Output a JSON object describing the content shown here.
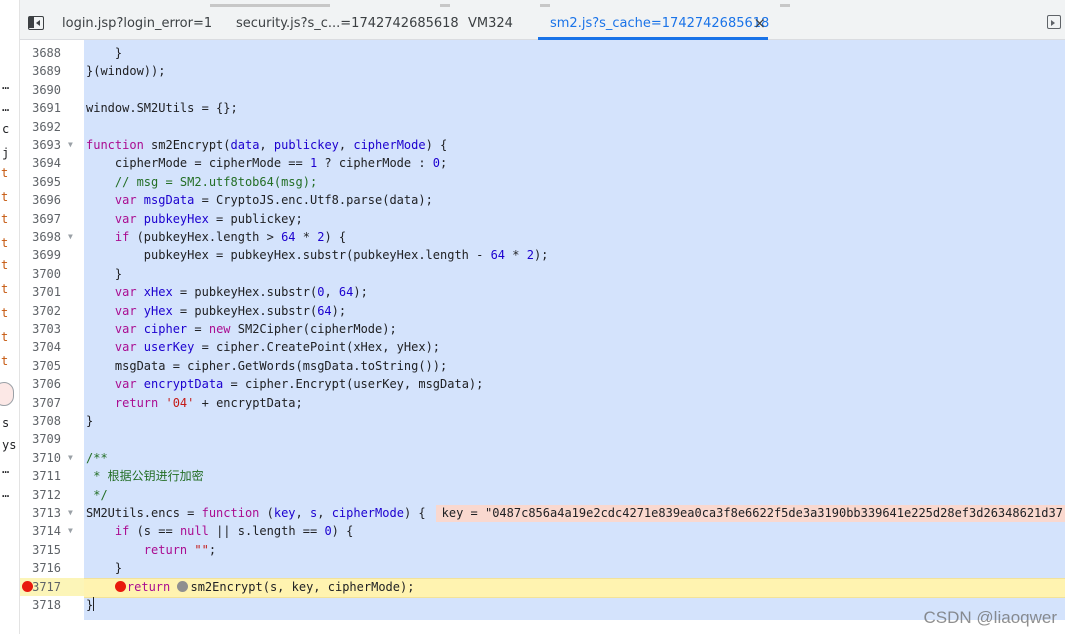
{
  "tabs": [
    {
      "label": "login.jsp?login_error=1",
      "active": false
    },
    {
      "label": "security.js?s_c...=1742742685618",
      "active": false
    },
    {
      "label": "VM324",
      "active": false
    },
    {
      "label": "sm2.js?s_cache=1742742685618",
      "active": true
    }
  ],
  "tab_close_glyph": "×",
  "left_panel_glyphs": [
    "…",
    "…",
    "c",
    "j",
    "t",
    "t",
    "t",
    "t",
    "t",
    "t",
    "t",
    "t",
    "t",
    "s",
    "ys",
    "…",
    "…"
  ],
  "code_lines": [
    {
      "num": "3688",
      "tokens": [
        [
          "plain",
          "    }"
        ]
      ]
    },
    {
      "num": "3689",
      "tokens": [
        [
          "plain",
          "}(window));"
        ]
      ]
    },
    {
      "num": "3690",
      "tokens": []
    },
    {
      "num": "3691",
      "tokens": [
        [
          "plain",
          "window.SM2Utils = {};"
        ]
      ]
    },
    {
      "num": "3692",
      "tokens": []
    },
    {
      "num": "3693",
      "fold": true,
      "tokens": [
        [
          "kw",
          "function "
        ],
        [
          "def",
          "sm2Encrypt"
        ],
        [
          "plain",
          "("
        ],
        [
          "var",
          "data"
        ],
        [
          "plain",
          ", "
        ],
        [
          "var",
          "publickey"
        ],
        [
          "plain",
          ", "
        ],
        [
          "var",
          "cipherMode"
        ],
        [
          "plain",
          ") {"
        ]
      ]
    },
    {
      "num": "3694",
      "tokens": [
        [
          "plain",
          "    cipherMode = cipherMode == "
        ],
        [
          "num",
          "1"
        ],
        [
          "plain",
          " ? cipherMode : "
        ],
        [
          "num",
          "0"
        ],
        [
          "plain",
          ";"
        ]
      ]
    },
    {
      "num": "3695",
      "tokens": [
        [
          "com",
          "    // msg = SM2.utf8tob64(msg);"
        ]
      ]
    },
    {
      "num": "3696",
      "tokens": [
        [
          "kw",
          "    var "
        ],
        [
          "var",
          "msgData"
        ],
        [
          "plain",
          " = CryptoJS.enc.Utf8.parse(data);"
        ]
      ]
    },
    {
      "num": "3697",
      "tokens": [
        [
          "kw",
          "    var "
        ],
        [
          "var",
          "pubkeyHex"
        ],
        [
          "plain",
          " = publickey;"
        ]
      ]
    },
    {
      "num": "3698",
      "fold": true,
      "tokens": [
        [
          "kw",
          "    if"
        ],
        [
          "plain",
          " (pubkeyHex.length > "
        ],
        [
          "num",
          "64"
        ],
        [
          "plain",
          " * "
        ],
        [
          "num",
          "2"
        ],
        [
          "plain",
          ") {"
        ]
      ]
    },
    {
      "num": "3699",
      "tokens": [
        [
          "plain",
          "        pubkeyHex = pubkeyHex.substr(pubkeyHex.length - "
        ],
        [
          "num",
          "64"
        ],
        [
          "plain",
          " * "
        ],
        [
          "num",
          "2"
        ],
        [
          "plain",
          ");"
        ]
      ]
    },
    {
      "num": "3700",
      "tokens": [
        [
          "plain",
          "    }"
        ]
      ]
    },
    {
      "num": "3701",
      "tokens": [
        [
          "kw",
          "    var "
        ],
        [
          "var",
          "xHex"
        ],
        [
          "plain",
          " = pubkeyHex.substr("
        ],
        [
          "num",
          "0"
        ],
        [
          "plain",
          ", "
        ],
        [
          "num",
          "64"
        ],
        [
          "plain",
          ");"
        ]
      ]
    },
    {
      "num": "3702",
      "tokens": [
        [
          "kw",
          "    var "
        ],
        [
          "var",
          "yHex"
        ],
        [
          "plain",
          " = pubkeyHex.substr("
        ],
        [
          "num",
          "64"
        ],
        [
          "plain",
          ");"
        ]
      ]
    },
    {
      "num": "3703",
      "tokens": [
        [
          "kw",
          "    var "
        ],
        [
          "var",
          "cipher"
        ],
        [
          "plain",
          " = "
        ],
        [
          "kw",
          "new "
        ],
        [
          "plain",
          "SM2Cipher(cipherMode);"
        ]
      ]
    },
    {
      "num": "3704",
      "tokens": [
        [
          "kw",
          "    var "
        ],
        [
          "var",
          "userKey"
        ],
        [
          "plain",
          " = cipher.CreatePoint(xHex, yHex);"
        ]
      ]
    },
    {
      "num": "3705",
      "tokens": [
        [
          "plain",
          "    msgData = cipher.GetWords(msgData.toString());"
        ]
      ]
    },
    {
      "num": "3706",
      "tokens": [
        [
          "kw",
          "    var "
        ],
        [
          "var",
          "encryptData"
        ],
        [
          "plain",
          " = cipher.Encrypt(userKey, msgData);"
        ]
      ]
    },
    {
      "num": "3707",
      "tokens": [
        [
          "kw",
          "    return "
        ],
        [
          "str",
          "'04'"
        ],
        [
          "plain",
          " + encryptData;"
        ]
      ]
    },
    {
      "num": "3708",
      "tokens": [
        [
          "plain",
          "}"
        ]
      ]
    },
    {
      "num": "3709",
      "tokens": []
    },
    {
      "num": "3710",
      "fold": true,
      "tokens": [
        [
          "com",
          "/**"
        ]
      ]
    },
    {
      "num": "3711",
      "tokens": [
        [
          "com",
          " * 根据公钥进行加密"
        ]
      ]
    },
    {
      "num": "3712",
      "tokens": [
        [
          "com",
          " */"
        ]
      ]
    },
    {
      "num": "3713",
      "fold": true,
      "tokens": [
        [
          "plain",
          "SM2Utils.encs = "
        ],
        [
          "kw",
          "function "
        ],
        [
          "plain",
          "("
        ],
        [
          "var",
          "key"
        ],
        [
          "plain",
          ", "
        ],
        [
          "var",
          "s"
        ],
        [
          "plain",
          ", "
        ],
        [
          "var",
          "cipherMode"
        ],
        [
          "plain",
          ") {"
        ]
      ],
      "inline_value": "key = \"0487c856a4a19e2cdc4271e839ea0ca3f8e6622f5de3a3190bb339641e225d28ef3d26348621d37"
    },
    {
      "num": "3714",
      "fold": true,
      "tokens": [
        [
          "kw",
          "    if"
        ],
        [
          "plain",
          " (s == "
        ],
        [
          "kw",
          "null"
        ],
        [
          "plain",
          " || s.length == "
        ],
        [
          "num",
          "0"
        ],
        [
          "plain",
          ") {"
        ]
      ]
    },
    {
      "num": "3715",
      "tokens": [
        [
          "kw",
          "        return "
        ],
        [
          "str",
          "\"\""
        ],
        [
          "plain",
          ";"
        ]
      ]
    },
    {
      "num": "3716",
      "tokens": [
        [
          "plain",
          "    }"
        ]
      ]
    },
    {
      "num": "3717",
      "current": true,
      "breakpoint": true,
      "tokens": [
        [
          "plain",
          "    "
        ],
        [
          "bp",
          ""
        ],
        [
          "kw",
          "return "
        ],
        [
          "bpgray",
          ""
        ],
        [
          "plain",
          "sm2Encrypt(s, key, cipherMode);"
        ]
      ]
    },
    {
      "num": "3718",
      "tokens": [
        [
          "plain",
          "}"
        ],
        [
          "cursor",
          ""
        ]
      ]
    }
  ],
  "watermark": "CSDN @liaoqwer",
  "colors": {
    "selection": "#d4e3fc",
    "active_tab": "#1a73e8",
    "breakpoint": "#e8190c",
    "current_line": "#fff3b0"
  }
}
